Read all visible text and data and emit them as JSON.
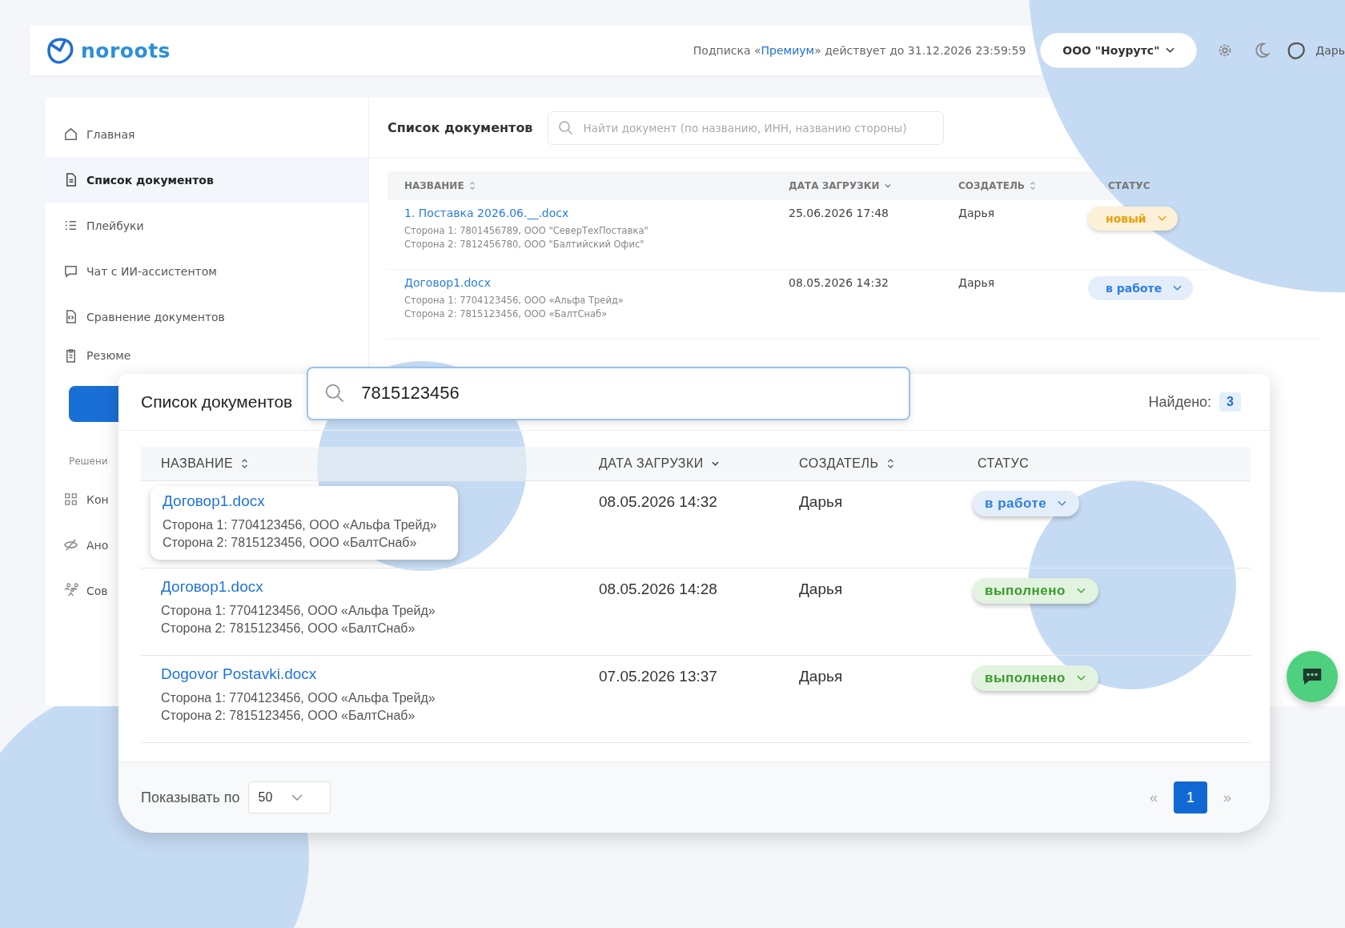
{
  "header": {
    "logo": "noroots",
    "subscription_before": "Подписка «",
    "plan": "Премиум",
    "subscription_after": "» действует до 31.12.2026 23:59:59",
    "org": "ООО \"Ноурутс\"",
    "user": "Дарь"
  },
  "sidebar": {
    "items": [
      {
        "label": "Главная",
        "selected": false
      },
      {
        "label": "Список документов",
        "selected": true
      },
      {
        "label": "Плейбуки",
        "selected": false
      },
      {
        "label": "Чат с ИИ-ассистентом",
        "selected": false
      },
      {
        "label": "Сравнение документов",
        "selected": false
      },
      {
        "label": "Резюме",
        "selected": false
      }
    ],
    "section": "Решени",
    "section_items": [
      {
        "label": "Кон"
      },
      {
        "label": "Ано"
      },
      {
        "label": "Сов"
      }
    ]
  },
  "documents": {
    "title": "Список документов",
    "search": {
      "placeholder": "Найти документ (по названию, ИНН, названию стороны)"
    },
    "columns": [
      {
        "label": "НАЗВАНИЕ"
      },
      {
        "label": "ДАТА ЗАГРУЗКИ"
      },
      {
        "label": "СОЗДАТЕЛЬ"
      },
      {
        "label": "СТАТУС"
      }
    ],
    "rows": [
      {
        "name": "1. Поставка 2026.06.__.docx",
        "party1": "Сторона 1: 7801456789, ООО \"СеверТехПоставка\"",
        "party2": "Сторона 2: 7812456780, ООО \"Балтийский Офис\"",
        "date": "25.06.2026 17:48",
        "creator": "Дарья",
        "status": {
          "label": "новый",
          "kind": "new"
        }
      },
      {
        "name": "Договор1.docx",
        "party1": "Сторона 1: 7704123456, ООО «Альфа Трейд»",
        "party2": "Сторона 2: 7815123456, ООО «БалтСнаб»",
        "date": "08.05.2026 14:32",
        "creator": "Дарья",
        "status": {
          "label": "в работе",
          "kind": "in_progress"
        }
      }
    ]
  },
  "search_results": {
    "title": "Список документов",
    "search": {
      "value": "7815123456"
    },
    "found_label": "Найдено:",
    "found_count": "3",
    "columns": [
      {
        "label": "НАЗВАНИЕ"
      },
      {
        "label": "ДАТА ЗАГРУЗКИ"
      },
      {
        "label": "СОЗДАТЕЛЬ"
      },
      {
        "label": "СТАТУС"
      }
    ],
    "rows": [
      {
        "name": "Договор1.docx",
        "party1": "Сторона 1: 7704123456, ООО «Альфа Трейд»",
        "party2": "Сторона 2: 7815123456, ООО «БалтСнаб»",
        "date": "08.05.2026 14:32",
        "creator": "Дарья",
        "status": {
          "label": "в работе",
          "kind": "in_progress"
        },
        "highlighted": true
      },
      {
        "name": "Договор1.docx",
        "party1": "Сторона 1: 7704123456, ООО «Альфа Трейд»",
        "party2": "Сторона 2: 7815123456, ООО «БалтСнаб»",
        "date": "08.05.2026 14:28",
        "creator": "Дарья",
        "status": {
          "label": "выполнено",
          "kind": "done"
        },
        "highlighted": false
      },
      {
        "name": "Dogovor Postavki.docx",
        "party1": "Сторона 1: 7704123456, ООО «Альфа Трейд»",
        "party2": "Сторона 2: 7815123456, ООО «БалтСнаб»",
        "date": "07.05.2026 13:37",
        "creator": "Дарья",
        "status": {
          "label": "выполнено",
          "kind": "done"
        },
        "highlighted": false
      }
    ],
    "page_size_label": "Показывать по",
    "page_size": "50",
    "prev": "«",
    "pages": [
      {
        "label": "1",
        "selected": true
      }
    ],
    "next": "»"
  }
}
